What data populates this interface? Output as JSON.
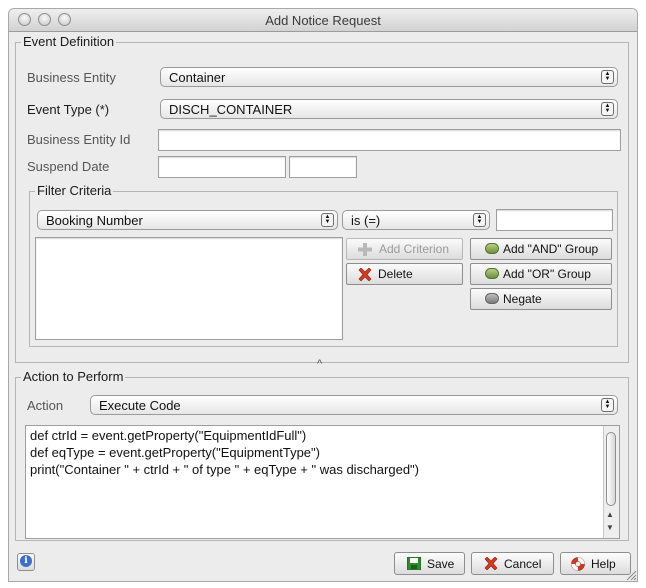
{
  "window": {
    "title": "Add Notice Request"
  },
  "event_definition": {
    "title": "Event Definition",
    "business_entity": {
      "label": "Business Entity",
      "value": "Container"
    },
    "event_type": {
      "label": "Event Type (*)",
      "value": "DISCH_CONTAINER"
    },
    "business_entity_id": {
      "label": "Business Entity Id",
      "value": ""
    },
    "suspend_date": {
      "label": "Suspend Date",
      "date_value": "",
      "time_value": ""
    }
  },
  "filter_criteria": {
    "title": "Filter Criteria",
    "field": "Booking Number",
    "operator": "is (=)",
    "value": "",
    "buttons": {
      "add_criterion": "Add Criterion",
      "delete": "Delete",
      "add_and_group": "Add \"AND\" Group",
      "add_or_group": "Add \"OR\" Group",
      "negate": "Negate"
    }
  },
  "splitter": {
    "glyph": "^"
  },
  "action": {
    "title": "Action to Perform",
    "label": "Action",
    "value": "Execute Code",
    "code_lines": [
      "def ctrId = event.getProperty(\"EquipmentIdFull\")",
      "def eqType = event.getProperty(\"EquipmentType\")",
      "print(\"Container \" + ctrId + \" of type \" + eqType + \" was discharged\")"
    ]
  },
  "footer": {
    "info_icon": "info-icon",
    "save": "Save",
    "cancel": "Cancel",
    "help": "Help"
  },
  "colors": {
    "window_bg": "#ececec",
    "delete_red": "#d33a20",
    "save_green": "#2e8b2e",
    "accent_green": "#6f8f3a"
  }
}
